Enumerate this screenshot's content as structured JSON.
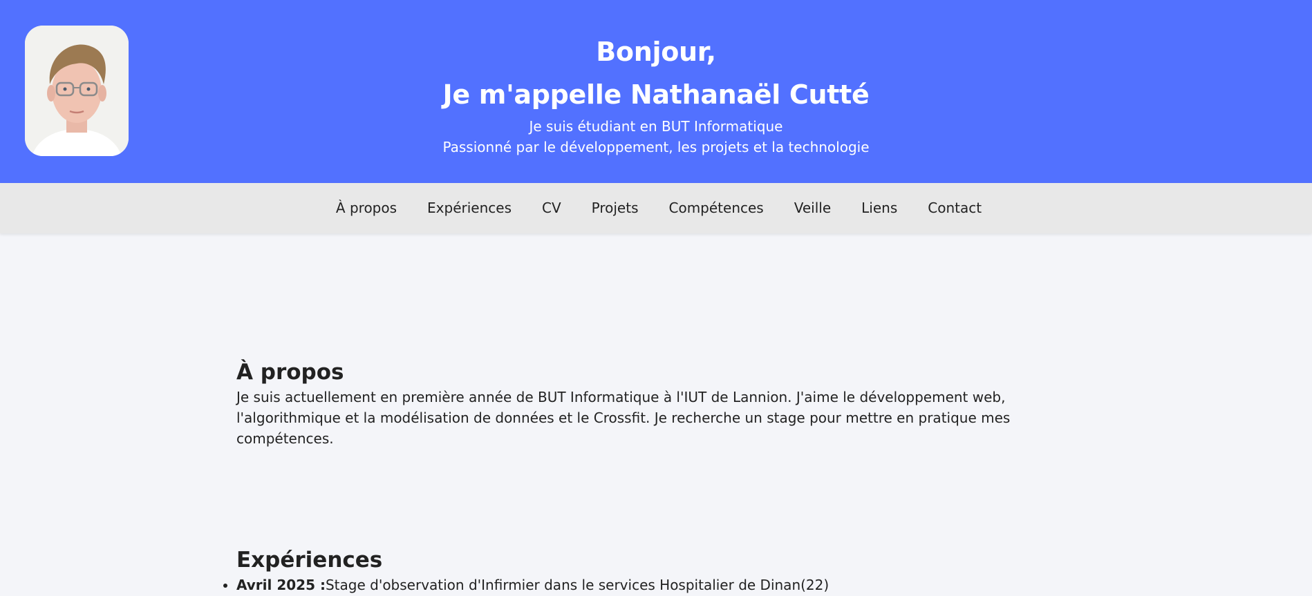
{
  "hero": {
    "greeting": "Bonjour,",
    "name_line": "Je m'appelle Nathanaël Cutté",
    "subtitle_1": "Je suis étudiant en BUT Informatique",
    "subtitle_2": "Passionné par le développement, les projets et la technologie",
    "background_color": "#5271ff"
  },
  "nav": {
    "items": [
      {
        "label": "À propos"
      },
      {
        "label": "Expériences"
      },
      {
        "label": "CV"
      },
      {
        "label": "Projets"
      },
      {
        "label": "Compétences"
      },
      {
        "label": "Veille"
      },
      {
        "label": "Liens"
      },
      {
        "label": "Contact"
      }
    ]
  },
  "about": {
    "title": "À propos",
    "text": "Je suis actuellement en première année de BUT Informatique à l'IUT de Lannion. J'aime le développement web, l'algorithmique et la modélisation de données et le Crossfit. Je recherche un stage pour mettre en pratique mes compétences."
  },
  "experiences": {
    "title": "Expériences",
    "items": [
      {
        "date": "Avril 2025 :",
        "text": "Stage d'observation d'Infirmier dans le services Hospitalier de Dinan(22)"
      }
    ]
  }
}
